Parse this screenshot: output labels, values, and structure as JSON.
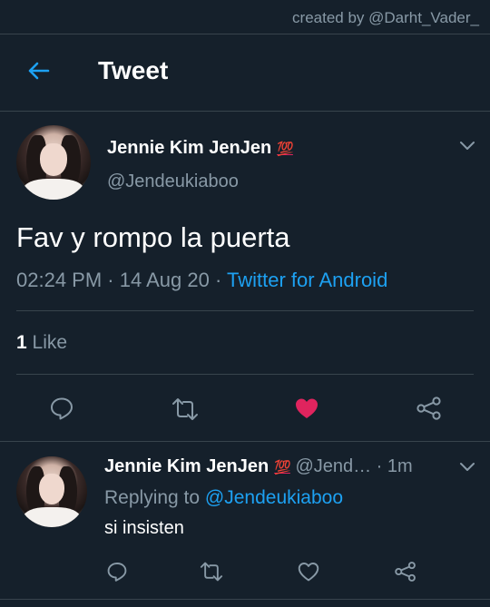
{
  "watermark": "created by @Darht_Vader_",
  "header": {
    "title": "Tweet"
  },
  "tweet": {
    "author_name": "Jennie Kim JenJen",
    "author_emoji": "💯",
    "handle": "@Jendeukiaboo",
    "text": "Fav y rompo la puerta",
    "time": "02:24 PM",
    "date_sep": " · ",
    "date": "14 Aug 20",
    "source_sep": " · ",
    "source": "Twitter for Android",
    "likes_count": "1",
    "likes_label": "Like",
    "liked": true
  },
  "reply": {
    "author_name": "Jennie Kim JenJen",
    "author_emoji": "💯",
    "handle": "@Jend…",
    "dot": " · ",
    "time": "1m",
    "replying_prefix": "Replying to ",
    "replying_target": "@Jendeukiaboo",
    "text": "si insisten"
  },
  "colors": {
    "background": "#15202b",
    "accent": "#1da1f2",
    "like": "#e0245e",
    "secondary_text": "#8899a6",
    "divider": "#38444d"
  },
  "icons": [
    "back-arrow-icon",
    "chevron-down-icon",
    "reply-icon",
    "retweet-icon",
    "heart-icon",
    "share-icon"
  ]
}
